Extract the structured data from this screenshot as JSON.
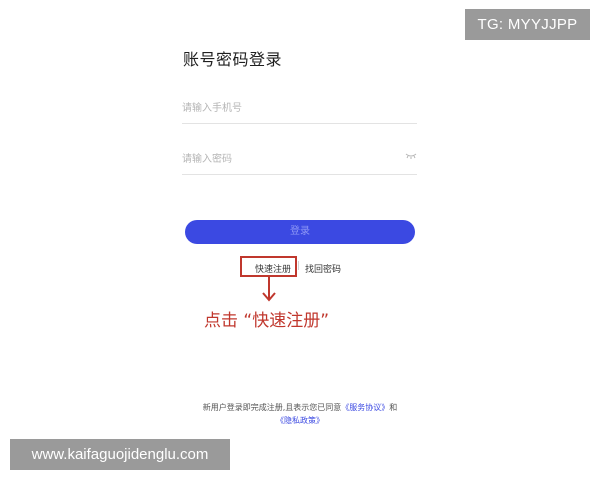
{
  "watermark": {
    "tg": "TG: MYYJJPP",
    "url": "www.kaifaguojidenglu.com"
  },
  "login": {
    "title": "账号密码登录",
    "phone_placeholder": "请输入手机号",
    "password_placeholder": "请输入密码",
    "button_label": "登录",
    "register_link": "快速注册",
    "separator": "|",
    "forgot_link": "找回密码"
  },
  "annotation": {
    "text": "点击 “快速注册”",
    "color": "#c0372d"
  },
  "agreement": {
    "prefix": "新用户登录即完成注册,且表示您已同意",
    "service": "《服务协议》",
    "and": "和",
    "privacy": "《隐私政策》"
  },
  "colors": {
    "primary": "#3b49e2",
    "annotation": "#c0372d",
    "badge": "#9a9a9a"
  },
  "icons": {
    "password_toggle": "eye-closed-icon",
    "annotation_arrow": "arrow-down-icon"
  }
}
